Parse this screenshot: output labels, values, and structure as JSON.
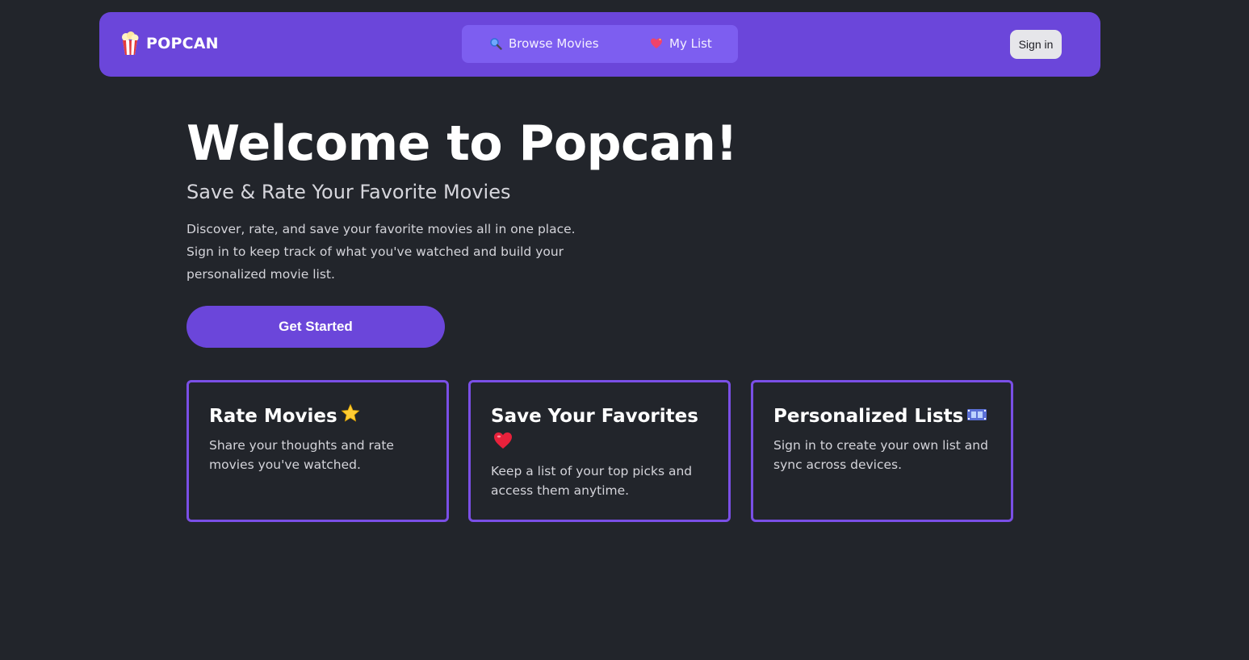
{
  "header": {
    "brand": "POPCAN",
    "brand_icon": "popcorn-icon",
    "nav": [
      {
        "label": "Browse Movies",
        "icon": "magnifier-icon"
      },
      {
        "label": "My List",
        "icon": "heart-icon"
      }
    ],
    "signin_label": "Sign in"
  },
  "hero": {
    "title": "Welcome to Popcan!",
    "subtitle": "Save & Rate Your Favorite Movies",
    "description": "Discover, rate, and save your favorite movies all in one place. Sign in to keep track of what you've watched and build your personalized movie list.",
    "cta_label": "Get Started"
  },
  "features": [
    {
      "title": "Rate Movies",
      "icon": "star-icon",
      "description": "Share your thoughts and rate movies you've watched."
    },
    {
      "title": "Save Your Favorites",
      "icon": "heart-icon",
      "description": "Keep a list of your top picks and access them anytime."
    },
    {
      "title": "Personalized Lists",
      "icon": "film-icon",
      "description": "Sign in to create your own list and sync across devices."
    }
  ],
  "colors": {
    "background": "#22252b",
    "accent": "#6b46da",
    "nav_pill": "#7d5ef0",
    "card_border": "#7a4fe6"
  }
}
